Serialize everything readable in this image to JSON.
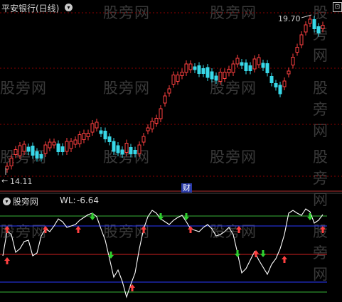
{
  "watermark": "股旁网",
  "main_panel": {
    "title": "平安银行(日线)",
    "high_label": "19.70",
    "low_label": "14.11",
    "event_badge": "财",
    "corner_icon": "gear-icon"
  },
  "indicator_panel": {
    "name": "股旁网",
    "wl_label": "WL:",
    "wl_value": "-6.64"
  },
  "colors": {
    "up": "#ff4040",
    "down": "#38d8e8",
    "grid": "#8b0000",
    "green_line": "#39b339",
    "blue_line": "#2a3aff",
    "red_line": "#d02020"
  },
  "chart_data": {
    "type": "candlestick",
    "price_range": [
      14.11,
      19.7
    ],
    "indicator": "WL",
    "indicator_last": -6.64
  }
}
